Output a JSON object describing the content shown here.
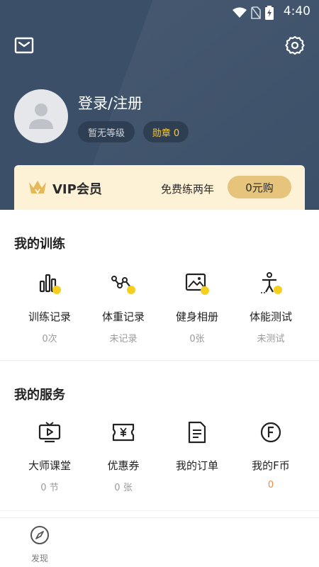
{
  "status_bar": {
    "time": "4:40",
    "icons": [
      "wifi-icon",
      "no-sim-icon",
      "battery-charging-icon"
    ]
  },
  "header": {
    "mail_icon": "mail-icon",
    "settings_icon": "gear-icon",
    "login_text": "登录/注册",
    "level_badge": "暂无等级",
    "medal_badge": "勋章 0",
    "bg_color": "#3b4f68"
  },
  "vip": {
    "title": "VIP会员",
    "promo": "免费练两年",
    "button": "0元购",
    "bg_color": "#fdf1d6",
    "button_color": "#e6c47c"
  },
  "training": {
    "title": "我的训练",
    "items": [
      {
        "label": "训练记录",
        "value": "0次",
        "icon": "bar-chart-icon"
      },
      {
        "label": "体重记录",
        "value": "未记录",
        "icon": "weight-trend-icon"
      },
      {
        "label": "健身相册",
        "value": "0张",
        "icon": "photo-album-icon"
      },
      {
        "label": "体能测试",
        "value": "未测试",
        "icon": "fitness-test-icon"
      }
    ]
  },
  "services": {
    "title": "我的服务",
    "items": [
      {
        "label": "大师课堂",
        "value": "0 节",
        "icon": "video-class-icon"
      },
      {
        "label": "优惠券",
        "value": "0 张",
        "icon": "coupon-icon"
      },
      {
        "label": "我的订单",
        "value": "",
        "icon": "order-list-icon"
      },
      {
        "label": "我的F币",
        "value": "0",
        "icon": "f-coin-icon"
      }
    ]
  },
  "bottom_nav": {
    "discover_label": "发现",
    "discover_icon": "compass-icon"
  },
  "accent_color": "#f5cf1f"
}
